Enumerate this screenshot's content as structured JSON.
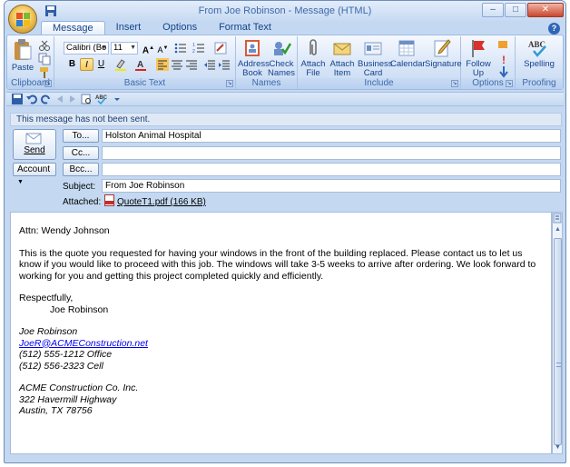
{
  "window": {
    "title": "From Joe Robinson - Message (HTML)",
    "controls": {
      "minimize": "–",
      "maximize": "□",
      "close": "✕"
    }
  },
  "tabs": [
    {
      "label": "Message",
      "active": true
    },
    {
      "label": "Insert",
      "active": false
    },
    {
      "label": "Options",
      "active": false
    },
    {
      "label": "Format Text",
      "active": false
    }
  ],
  "help_label": "?",
  "ribbon": {
    "clipboard": {
      "label": "Clipboard",
      "paste": "Paste"
    },
    "basic_text": {
      "label": "Basic Text",
      "font": "Calibri (Bo",
      "size": "11"
    },
    "names": {
      "label": "Names",
      "address_book": "Address Book",
      "check_names": "Check Names"
    },
    "include": {
      "label": "Include",
      "attach_file": "Attach File",
      "attach_item": "Attach Item",
      "business_card": "Business Card",
      "calendar": "Calendar",
      "signature": "Signature"
    },
    "options": {
      "label": "Options",
      "follow_up": "Follow Up"
    },
    "proofing": {
      "label": "Proofing",
      "spelling": "Spelling"
    }
  },
  "infobar": "This message has not been sent.",
  "header": {
    "send": "Send",
    "to_button": "To...",
    "cc_button": "Cc...",
    "bcc_button": "Bcc...",
    "account_button": "Account",
    "to_value": "Holston Animal Hospital",
    "cc_value": "",
    "bcc_value": "",
    "subject_label": "Subject:",
    "subject_value": "From Joe Robinson",
    "attached_label": "Attached:",
    "attachment": "QuoteT1.pdf (166 KB)"
  },
  "body": {
    "greeting": "Attn:  Wendy Johnson",
    "paragraph": "This is the quote you requested for having your windows in the front of the building replaced.  Please contact us to let us know if you would like to proceed with this job.  The windows will take 3-5 weeks to arrive after ordering.  We look forward to working for you and getting this project completed quickly and efficiently.",
    "closing": "Respectfully,",
    "closing_name": "Joe Robinson",
    "signature": {
      "name": "Joe Robinson",
      "email": "JoeR@ACMEConstruction.net",
      "office": "(512) 555-1212 Office",
      "cell": "(512) 556-2323 Cell",
      "company": "ACME Construction Co. Inc.",
      "street": "322 Havermill Highway",
      "city": "Austin, TX 78756"
    }
  },
  "colors": {
    "accent": "#15428b",
    "ribbon": "#d6e4f7",
    "link": "#0000ee"
  }
}
